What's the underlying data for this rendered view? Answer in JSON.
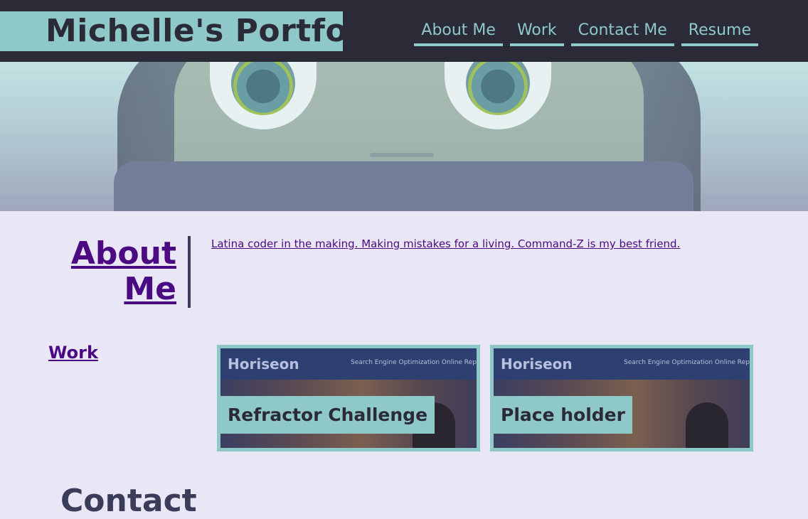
{
  "header": {
    "title": "Michelle's Portfolio",
    "nav": [
      "About Me",
      "Work",
      "Contact Me",
      "Resume"
    ]
  },
  "about": {
    "title_line1": "About",
    "title_line2": "Me",
    "text": "Latina coder in the making. Making mistakes for a living. Command-Z is my best friend."
  },
  "work": {
    "title": "Work",
    "projects": [
      {
        "label": "Refractor Challenge",
        "screenshot_logo": "Horiseon",
        "screenshot_nav": "Search Engine Optimization     Online Reputati"
      },
      {
        "label": "Place holder",
        "screenshot_logo": "Horiseon",
        "screenshot_nav": "Search Engine Optimization     Online Reputati"
      }
    ]
  },
  "contact": {
    "title": "Contact"
  },
  "colors": {
    "header_bg": "#2b2b37",
    "accent": "#8fc8c8",
    "link": "#4b0a82",
    "page_bg": "#e9e7f5"
  }
}
